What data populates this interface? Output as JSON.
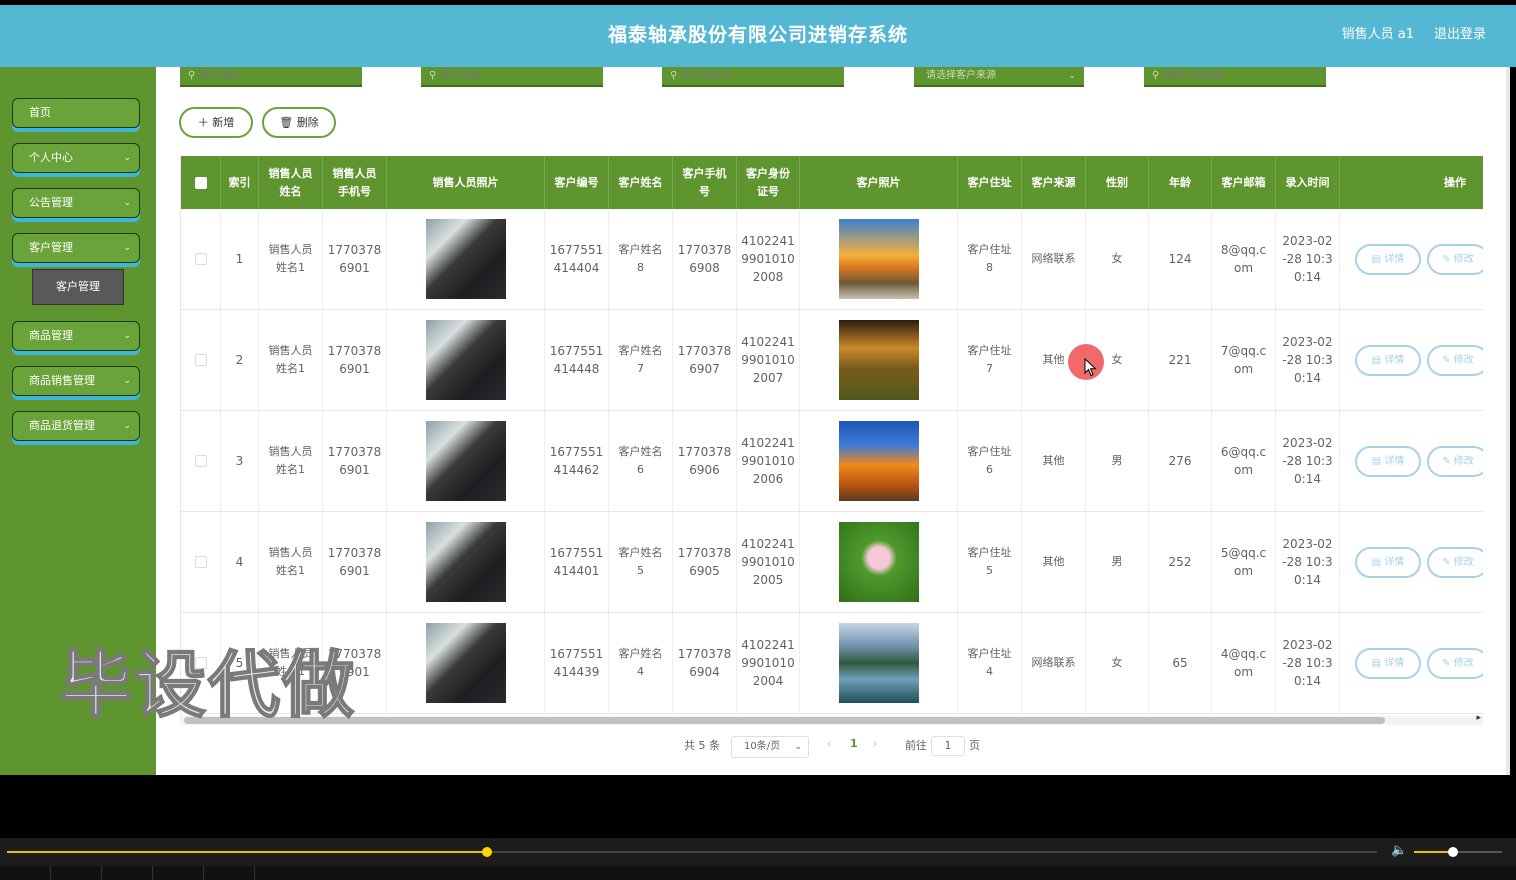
{
  "header": {
    "title": "福泰轴承股份有限公司进销存系统",
    "user": "销售人员 a1",
    "logout": "退出登录"
  },
  "sidebar": {
    "items": [
      {
        "label": "首页",
        "has_children": false
      },
      {
        "label": "个人中心",
        "has_children": true
      },
      {
        "label": "公告管理",
        "has_children": true
      },
      {
        "label": "客户管理",
        "has_children": true
      },
      {
        "label": "商品管理",
        "has_children": true
      },
      {
        "label": "商品销售管理",
        "has_children": true
      },
      {
        "label": "商品退货管理",
        "has_children": true
      }
    ],
    "sub_item": "客户管理",
    "chevron": "⌄"
  },
  "filters": [
    {
      "placeholder": "客户编号",
      "type": "input"
    },
    {
      "placeholder": "客户姓名",
      "type": "input"
    },
    {
      "placeholder": "客户手机号",
      "type": "input"
    },
    {
      "placeholder": "请选择客户来源",
      "type": "select"
    },
    {
      "placeholder": "销售人员姓名",
      "type": "input"
    }
  ],
  "toolbar": {
    "add_label": "新增",
    "delete_label": "删除",
    "add_icon": "plus-icon",
    "delete_icon": "trash-icon"
  },
  "table": {
    "headers": [
      "",
      "索引",
      "销售人员\n姓名",
      "销售人员\n手机号",
      "销售人员照片",
      "客户编号",
      "客户姓名",
      "客户手机\n号",
      "客户身份\n证号",
      "客户照片",
      "客户住址",
      "客户来源",
      "性别",
      "年龄",
      "客户邮箱",
      "录入时间",
      "操作"
    ],
    "rows": [
      {
        "index": "1",
        "seller_name": "销售人员\n姓名1",
        "seller_phone": "1770378\n6901",
        "customer_no": "1677551\n414404",
        "customer_name": "客户姓名\n8",
        "customer_phone": "1770378\n6908",
        "id_no": "4102241\n9901010\n2008",
        "photo": "sunset-coast",
        "address": "客户住址\n8",
        "source": "网络联系",
        "gender": "女",
        "age": "124",
        "email": "8@qq.c\nom",
        "time": "2023-02\n-28 10:3\n0:14"
      },
      {
        "index": "2",
        "seller_name": "销售人员\n姓名1",
        "seller_phone": "1770378\n6901",
        "customer_no": "1677551\n414448",
        "customer_name": "客户姓名\n7",
        "customer_phone": "1770378\n6907",
        "id_no": "4102241\n9901010\n2007",
        "photo": "golden-hills",
        "address": "客户住址\n7",
        "source": "其他",
        "gender": "女",
        "age": "221",
        "email": "7@qq.c\nom",
        "time": "2023-02\n-28 10:3\n0:14"
      },
      {
        "index": "3",
        "seller_name": "销售人员\n姓名1",
        "seller_phone": "1770378\n6901",
        "customer_no": "1677551\n414462",
        "customer_name": "客户姓名\n6",
        "customer_phone": "1770378\n6906",
        "id_no": "4102241\n9901010\n2006",
        "photo": "orange-rock",
        "address": "客户住址\n6",
        "source": "其他",
        "gender": "男",
        "age": "276",
        "email": "6@qq.c\nom",
        "time": "2023-02\n-28 10:3\n0:14"
      },
      {
        "index": "4",
        "seller_name": "销售人员\n姓名1",
        "seller_phone": "1770378\n6901",
        "customer_no": "1677551\n414401",
        "customer_name": "客户姓名\n5",
        "customer_phone": "1770378\n6905",
        "id_no": "4102241\n9901010\n2005",
        "photo": "lotus",
        "address": "客户住址\n5",
        "source": "其他",
        "gender": "男",
        "age": "252",
        "email": "5@qq.c\nom",
        "time": "2023-02\n-28 10:3\n0:14"
      },
      {
        "index": "5",
        "seller_name": "销售人员\n姓名1",
        "seller_phone": "1770378\n6901",
        "customer_no": "1677551\n414439",
        "customer_name": "客户姓名\n4",
        "customer_phone": "1770378\n6904",
        "id_no": "4102241\n9901010\n2004",
        "photo": "lake-mountains",
        "address": "客户住址\n4",
        "source": "网络联系",
        "gender": "女",
        "age": "65",
        "email": "4@qq.c\nom",
        "time": "2023-02\n-28 10:3\n0:14"
      }
    ],
    "actions": {
      "detail": "详情",
      "edit": "修改"
    }
  },
  "pagination": {
    "total": "共 5 条",
    "page_size": "10条/页",
    "current_page": "1",
    "goto_label": "前往",
    "goto_value": "1",
    "page_unit": "页",
    "prev": "‹",
    "next": "›"
  },
  "watermark": "毕设代做",
  "player": {
    "progress": 0.35,
    "volume": 0.44
  },
  "colors": {
    "header": "#54b7d3",
    "sidebar": "#5f952e",
    "accent": "#6aa33a",
    "action_outline": "#a6d3e6"
  }
}
